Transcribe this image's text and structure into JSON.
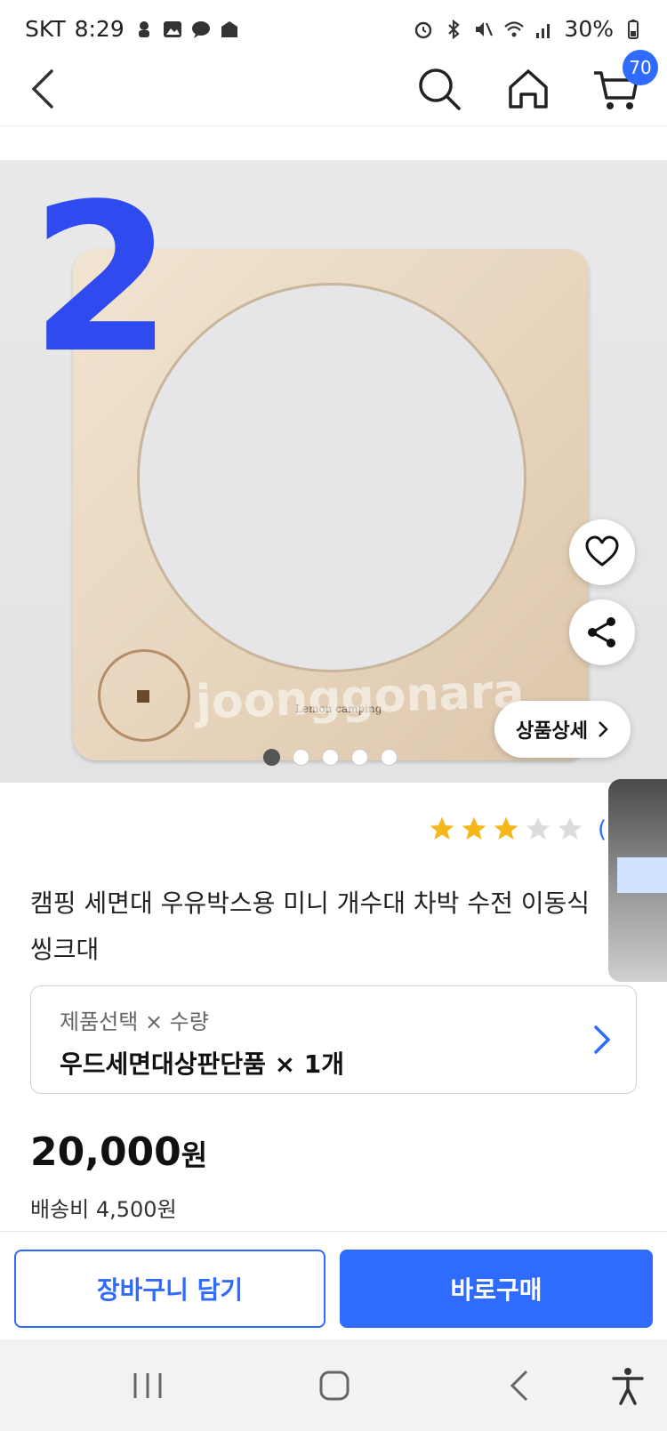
{
  "status_bar": {
    "carrier": "SKT",
    "time": "8:29",
    "battery": "30%",
    "left_icons": [
      "notification-icon",
      "image-icon",
      "chat-icon",
      "app-icon"
    ],
    "right_icons": [
      "alarm-icon",
      "bluetooth-icon",
      "mute-icon",
      "wifi-icon",
      "signal-icon",
      "battery-icon"
    ]
  },
  "header": {
    "cart_count": "70",
    "icons": [
      "back-icon",
      "search-icon",
      "home-icon",
      "cart-icon"
    ]
  },
  "gallery": {
    "image_number_mark": "2",
    "product_brand_print": "Lemon camping",
    "watermark": "joonggonara",
    "detail_button_label": "상품상세",
    "slide_count": 5,
    "active_slide_index": 0
  },
  "product": {
    "rating_stars_filled": 3,
    "rating_stars_total": 5,
    "rating_paren": "(",
    "title": "캠핑 세면대 우유박스용 미니 개수대 차박 수전 이동식 씽크대",
    "option_label": "제품선택 × 수량",
    "option_value": "우드세면대상판단품 × 1개",
    "price_number": "20,000",
    "price_unit": "원",
    "shipping": "배송비 4,500원"
  },
  "actions": {
    "add_to_cart": "장바구니 담기",
    "buy_now": "바로구매"
  },
  "colors": {
    "accent": "#2f6bff",
    "star_filled": "#f5b71b",
    "star_empty": "#dcdcdc"
  }
}
